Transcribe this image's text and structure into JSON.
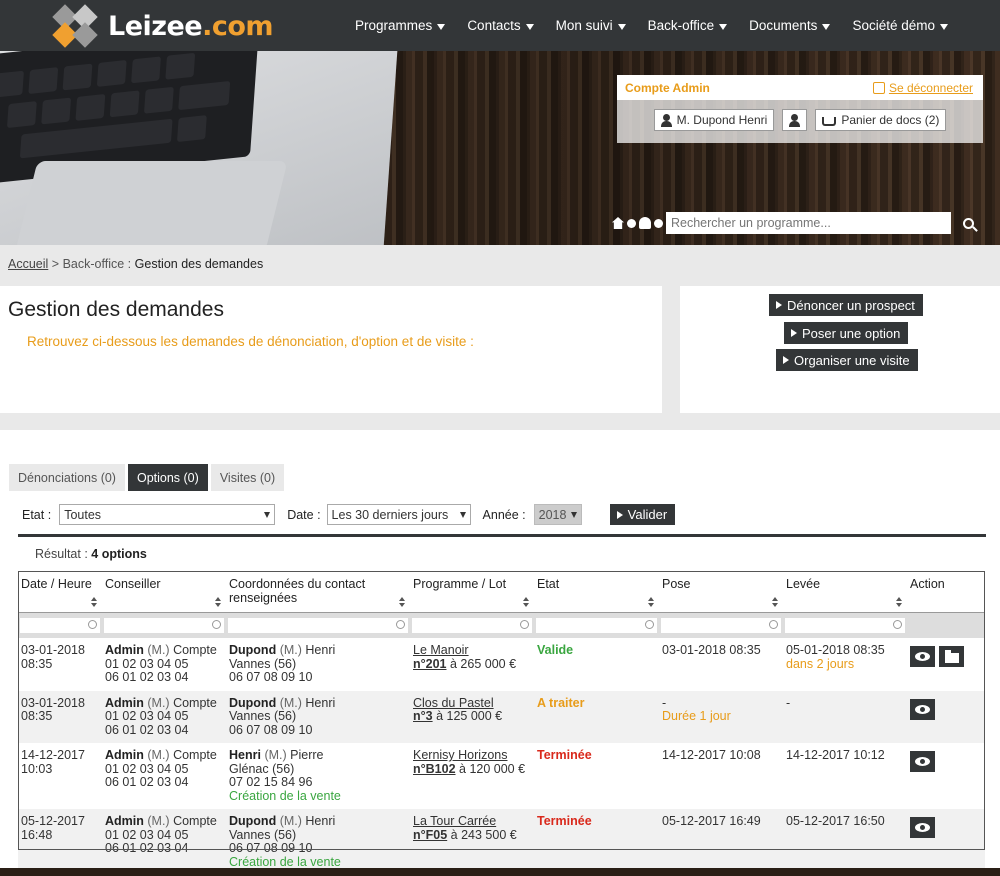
{
  "brand": {
    "name": "Leizee",
    "tld": ".com"
  },
  "nav": [
    {
      "label": "Programmes"
    },
    {
      "label": "Contacts"
    },
    {
      "label": "Mon suivi"
    },
    {
      "label": "Back-office"
    },
    {
      "label": "Documents"
    },
    {
      "label": "Société démo"
    }
  ],
  "account": {
    "title": "Compte Admin",
    "logout": "Se déconnecter",
    "user": "M. Dupond Henri",
    "cart": "Panier de docs (2)"
  },
  "search": {
    "placeholder": "Rechercher un programme..."
  },
  "breadcrumb": {
    "home": "Accueil",
    "sep1": ">",
    "section": "Back-office",
    "sep2": ":",
    "current": "Gestion des demandes"
  },
  "page": {
    "title": "Gestion des demandes",
    "subtitle": "Retrouvez ci-dessous les demandes de dénonciation, d'option et de visite :"
  },
  "actions": {
    "denounce": "Dénoncer un prospect",
    "option": "Poser une option",
    "visit": "Organiser une visite"
  },
  "tabs": [
    {
      "label": "Dénonciations (0)"
    },
    {
      "label": "Options (0)"
    },
    {
      "label": "Visites (0)"
    }
  ],
  "filters": {
    "etat_label": "Etat :",
    "etat_value": "Toutes",
    "date_label": "Date :",
    "date_value": "Les 30 derniers jours",
    "annee_label": "Année :",
    "annee_value": "2018",
    "submit": "Valider"
  },
  "result": {
    "label": "Résultat :",
    "value": "4 options"
  },
  "table": {
    "headers": [
      "Date / Heure",
      "Conseiller",
      "Coordonnées du contact renseignées",
      "Programme / Lot",
      "Etat",
      "Pose",
      "Levée",
      "Action"
    ],
    "rows": [
      {
        "date": "03-01-2018",
        "time": "08:35",
        "adv_name": "Admin",
        "adv_civ": "(M.)",
        "adv_first": "Compte",
        "adv_p1": "01 02 03 04 05",
        "adv_p2": "06 01 02 03 04",
        "ct_name": "Dupond",
        "ct_civ": "(M.)",
        "ct_first": "Henri",
        "ct_city": "Vannes (56)",
        "ct_phone": "06 07 08 09 10",
        "ct_note": "",
        "prog": "Le Manoir",
        "lot": "n°201",
        "price": "à 265 000 €",
        "state": "Valide",
        "pose": "03-01-2018 08:35",
        "pose_note": "",
        "levee": "05-01-2018 08:35",
        "levee_note": "dans 2 jours"
      },
      {
        "date": "03-01-2018",
        "time": "08:35",
        "adv_name": "Admin",
        "adv_civ": "(M.)",
        "adv_first": "Compte",
        "adv_p1": "01 02 03 04 05",
        "adv_p2": "06 01 02 03 04",
        "ct_name": "Dupond",
        "ct_civ": "(M.)",
        "ct_first": "Henri",
        "ct_city": "Vannes (56)",
        "ct_phone": "06 07 08 09 10",
        "ct_note": "",
        "prog": "Clos du Pastel",
        "lot": "n°3",
        "price": "à 125 000 €",
        "state": "A traiter",
        "pose": "-",
        "pose_note": "Durée 1 jour",
        "levee": "-",
        "levee_note": ""
      },
      {
        "date": "14-12-2017",
        "time": "10:03",
        "adv_name": "Admin",
        "adv_civ": "(M.)",
        "adv_first": "Compte",
        "adv_p1": "01 02 03 04 05",
        "adv_p2": "06 01 02 03 04",
        "ct_name": "Henri",
        "ct_civ": "(M.)",
        "ct_first": "Pierre",
        "ct_city": "Glénac (56)",
        "ct_phone": "07 02 15 84 96",
        "ct_note": "Création de la vente",
        "prog": "Kernisy Horizons",
        "lot": "n°B102",
        "price": "à 120 000 €",
        "state": "Terminée",
        "pose": "14-12-2017 10:08",
        "pose_note": "",
        "levee": "14-12-2017 10:12",
        "levee_note": ""
      },
      {
        "date": "05-12-2017",
        "time": "16:48",
        "adv_name": "Admin",
        "adv_civ": "(M.)",
        "adv_first": "Compte",
        "adv_p1": "01 02 03 04 05",
        "adv_p2": "06 01 02 03 04",
        "ct_name": "Dupond",
        "ct_civ": "(M.)",
        "ct_first": "Henri",
        "ct_city": "Vannes (56)",
        "ct_phone": "06 07 08 09 10",
        "ct_note": "Création de la vente",
        "prog": "La Tour Carrée",
        "lot": "n°F05",
        "price": "à 243 500 €",
        "state": "Terminée",
        "pose": "05-12-2017 16:49",
        "pose_note": "",
        "levee": "05-12-2017 16:50",
        "levee_note": ""
      }
    ]
  },
  "colors": {
    "accent": "#e89c1a",
    "dark": "#333638",
    "valid": "#3aa640",
    "terminated": "#d9291c"
  }
}
